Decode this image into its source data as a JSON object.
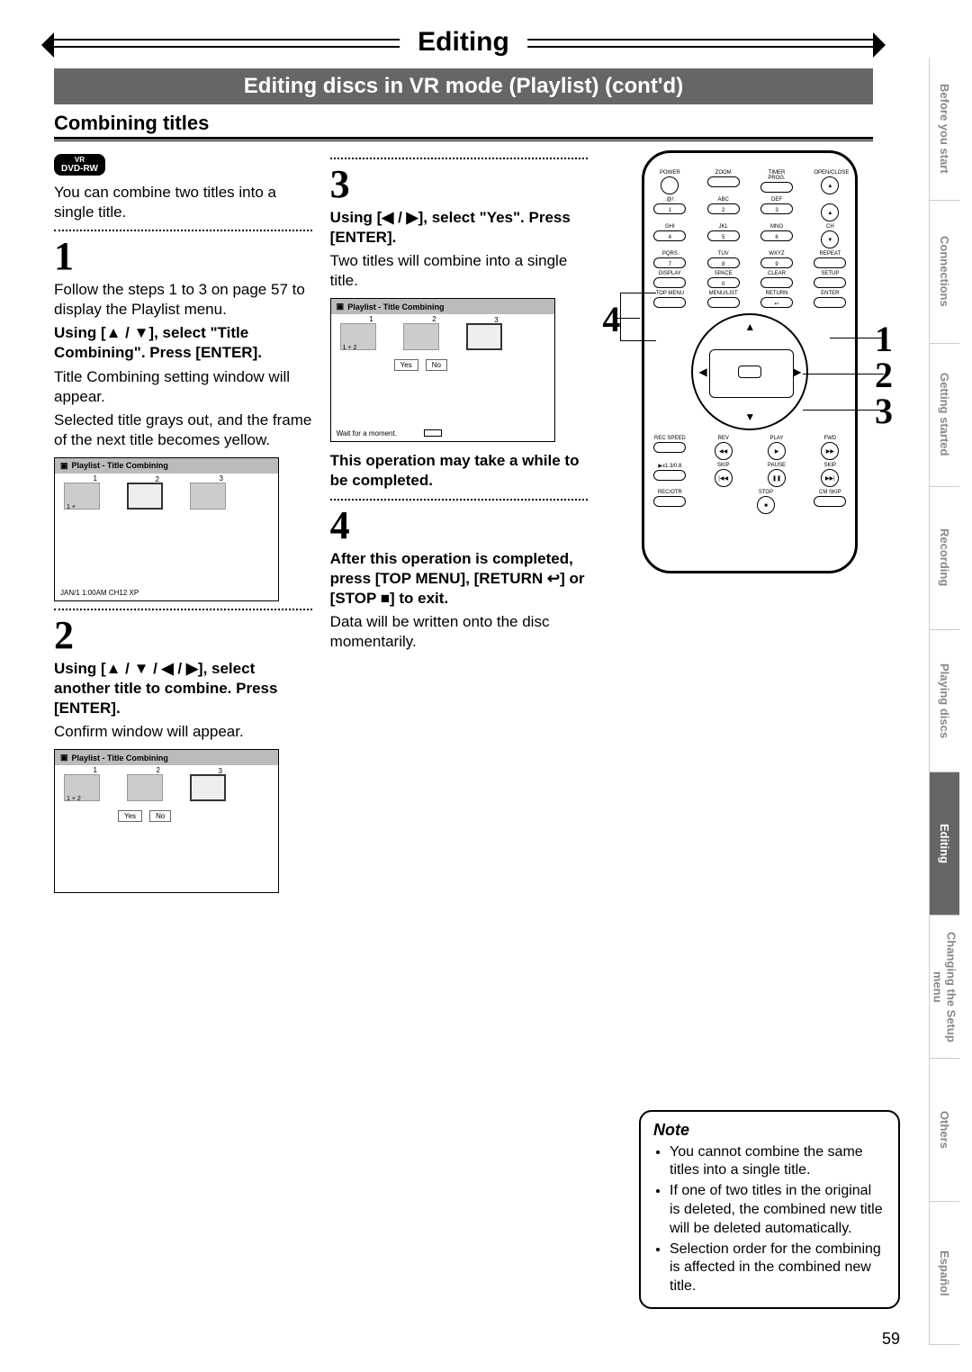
{
  "banner": {
    "title": "Editing"
  },
  "subtitle": "Editing discs in VR mode (Playlist) (cont'd)",
  "section": "Combining titles",
  "dvd_badge": {
    "top": "VR",
    "bottom": "DVD-RW"
  },
  "intro": "You can combine two titles into a single title.",
  "step1": {
    "num": "1",
    "p1": "Follow the steps 1 to 3 on page 57 to display the Playlist menu.",
    "b1": "Using [▲ / ▼], select \"Title Combining\". Press [ENTER].",
    "p2": "Title Combining setting window will appear.",
    "p3": "Selected title grays out, and the frame of the next title becomes yellow.",
    "screen": {
      "header": "Playlist - Title Combining",
      "thumb1_top": "1",
      "thumb1_caption": "1 +",
      "thumb2_top": "2",
      "thumb3_top": "3",
      "status": "JAN/1 1:00AM CH12 XP"
    }
  },
  "step2": {
    "num": "2",
    "b1": "Using [▲ / ▼ / ◀ / ▶], select another title to combine. Press [ENTER].",
    "p1": "Confirm window will appear.",
    "screen": {
      "header": "Playlist - Title Combining",
      "thumb1_top": "1",
      "thumb1_caption": "1 + 2",
      "thumb2_top": "2",
      "thumb3_top": "3",
      "yes": "Yes",
      "no": "No"
    }
  },
  "step3": {
    "num": "3",
    "b1": "Using [◀ / ▶], select \"Yes\". Press [ENTER].",
    "p1": "Two titles will combine into a single title.",
    "screen": {
      "header": "Playlist - Title Combining",
      "thumb1_top": "1",
      "thumb1_caption": "1 + 2",
      "thumb2_top": "2",
      "thumb3_top": "3",
      "yes": "Yes",
      "no": "No",
      "status": "Wait for a moment."
    },
    "b2": "This operation may take a while to be completed."
  },
  "step4": {
    "num": "4",
    "b1": "After this operation is completed, press [TOP MENU], [RETURN ↩] or [STOP ■] to exit.",
    "p1": "Data will be written onto the disc momentarily."
  },
  "remote": {
    "labels": {
      "power": "POWER",
      "openclose": "OPEN/CLOSE",
      "zoom": "ZOOM",
      "timer": "TIMER PROG.",
      "sym": ".@/:",
      "abc": "ABC",
      "def": "DEF",
      "ghi": "GHI",
      "jkl": "JKL",
      "mno": "MNO",
      "ch": "CH",
      "pqrs": "PQRS",
      "tuv": "TUV",
      "wxyz": "WXYZ",
      "repeat": "REPEAT",
      "display": "DISPLAY",
      "space": "SPACE",
      "clear": "CLEAR",
      "setup": "SETUP",
      "topmenu": "TOP MENU",
      "menulist": "MENU/LIST",
      "return": "RETURN",
      "enter": "ENTER",
      "recspeed": "REC SPEED",
      "rev": "REV",
      "play": "PLAY",
      "fwd": "FWD",
      "x13": "▶x1.3/0.8",
      "skip1": "SKIP",
      "pause": "PAUSE",
      "skip2": "SKIP",
      "recotr": "REC/OTR",
      "stop": "STOP",
      "cmskip": "CM SKIP"
    },
    "nums": {
      "n1": "1",
      "n2": "2",
      "n3": "3",
      "n4": "4",
      "n5": "5",
      "n6": "6",
      "n7": "7",
      "n8": "8",
      "n9": "9",
      "n0": "0"
    },
    "callouts": {
      "c1": "1",
      "c2": "2",
      "c3": "3",
      "c4": "4"
    }
  },
  "sidebar": [
    {
      "label": "Before you start",
      "active": false
    },
    {
      "label": "Connections",
      "active": false
    },
    {
      "label": "Getting started",
      "active": false
    },
    {
      "label": "Recording",
      "active": false
    },
    {
      "label": "Playing discs",
      "active": false
    },
    {
      "label": "Editing",
      "active": true
    },
    {
      "label": "Changing the Setup menu",
      "active": false
    },
    {
      "label": "Others",
      "active": false
    },
    {
      "label": "Español",
      "active": false
    }
  ],
  "note": {
    "title": "Note",
    "items": [
      "You cannot combine the same titles into a single title.",
      "If one of two titles in the original is deleted, the combined new title will be deleted automatically.",
      "Selection order for the combining is affected in the combined new title."
    ]
  },
  "page_number": "59"
}
